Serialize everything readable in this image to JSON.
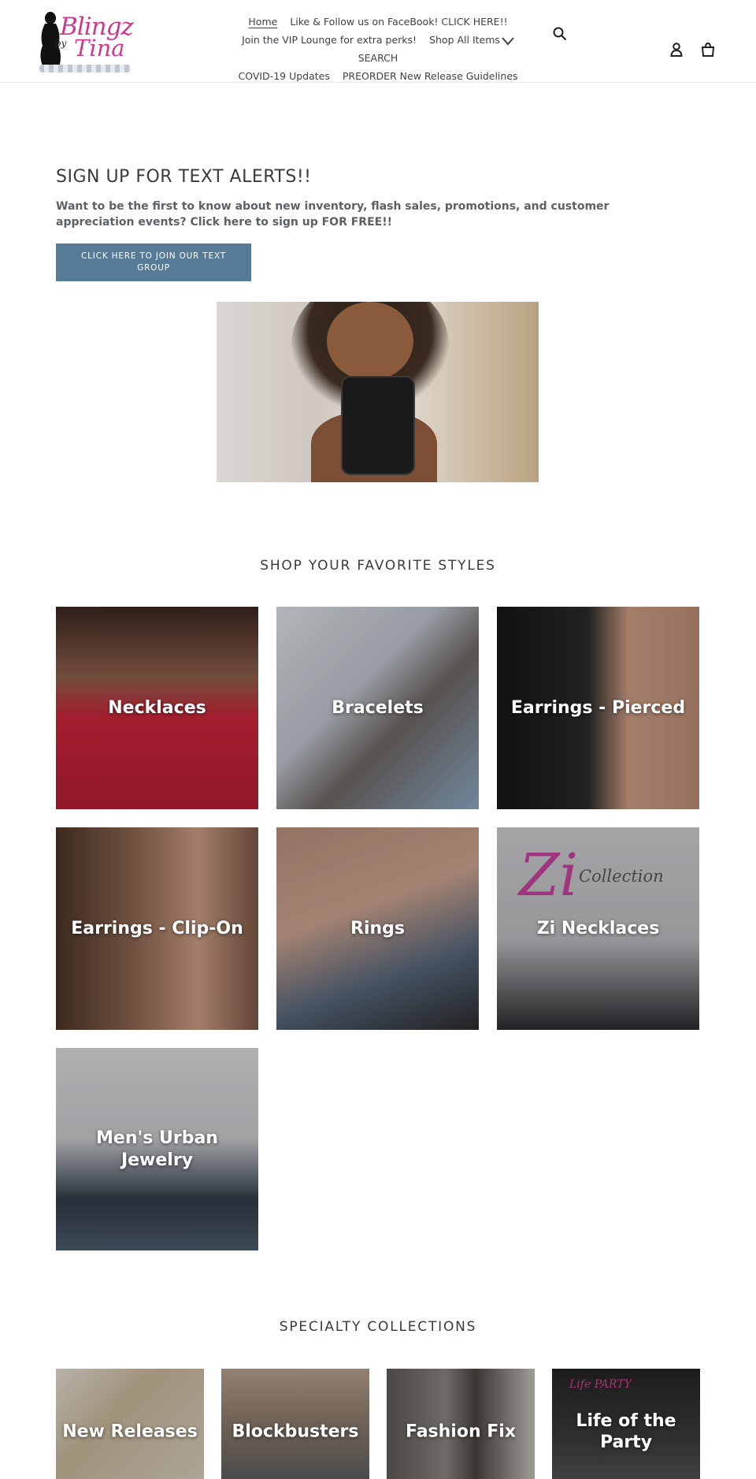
{
  "header": {
    "logo_text_line1": "Blingz",
    "logo_text_by": "by",
    "logo_text_line2": "Tina",
    "nav": [
      {
        "label": "Home",
        "active": true
      },
      {
        "label": "Like & Follow us on FaceBook! CLICK HERE!!"
      },
      {
        "label": "Join the VIP Lounge for extra perks!"
      },
      {
        "label": "Shop All Items",
        "has_dropdown": true
      },
      {
        "label": "SEARCH"
      },
      {
        "label": "COVID-19 Updates"
      },
      {
        "label": "PREORDER New Release Guidelines"
      }
    ],
    "icons": {
      "search": "search-icon",
      "account": "account-icon",
      "cart": "cart-icon"
    }
  },
  "text_alerts": {
    "title": "SIGN UP FOR TEXT ALERTS!!",
    "body": "Want to be the first to know about new inventory, flash sales, promotions, and customer appreciation events? Click here to sign up FOR FREE!!",
    "button": "CLICK HERE TO JOIN OUR TEXT GROUP"
  },
  "favorites": {
    "title": "SHOP YOUR FAVORITE STYLES",
    "tiles": [
      {
        "label": "Necklaces"
      },
      {
        "label": "Bracelets"
      },
      {
        "label": "Earrings - Pierced"
      },
      {
        "label": "Earrings - Clip-On"
      },
      {
        "label": "Rings"
      },
      {
        "label": "Zi Necklaces",
        "image_text_1": "Zi",
        "image_text_2": "Collection"
      },
      {
        "label": "Men's Urban Jewelry"
      }
    ]
  },
  "specialty": {
    "title": "SPECIALTY COLLECTIONS",
    "tiles": [
      {
        "label": "New Releases"
      },
      {
        "label": "Blockbusters"
      },
      {
        "label": "Fashion Fix"
      },
      {
        "label": "Life of the Party",
        "image_text": "Life PARTY"
      }
    ]
  },
  "colors": {
    "button_bg": "#557b97",
    "logo_pink": "#d1378c",
    "text": "#3a3a3a"
  }
}
